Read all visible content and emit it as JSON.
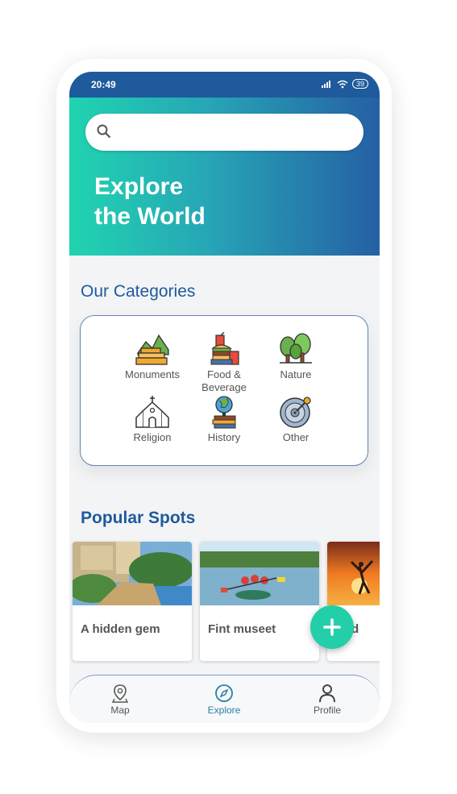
{
  "status_bar": {
    "time": "20:49",
    "battery": "39"
  },
  "search": {
    "placeholder": ""
  },
  "hero": {
    "title_line1": "Explore",
    "title_line2": "the World"
  },
  "categories": {
    "heading": "Our Categories",
    "items": [
      {
        "label": "Monuments",
        "icon": "monument-icon"
      },
      {
        "label": "Food & Beverage",
        "icon": "food-icon"
      },
      {
        "label": "Nature",
        "icon": "trees-icon"
      },
      {
        "label": "Religion",
        "icon": "church-icon"
      },
      {
        "label": "History",
        "icon": "globe-books-icon"
      },
      {
        "label": "Other",
        "icon": "vinyl-icon"
      }
    ]
  },
  "popular": {
    "heading": "Popular Spots",
    "spots": [
      {
        "title": "A hidden gem"
      },
      {
        "title": "Fint museet"
      },
      {
        "title": "And"
      }
    ]
  },
  "fab": {
    "icon": "plus-icon"
  },
  "nav": {
    "items": [
      {
        "label": "Map",
        "icon": "map-pin-icon"
      },
      {
        "label": "Explore",
        "icon": "compass-icon",
        "active": true
      },
      {
        "label": "Profile",
        "icon": "user-icon"
      }
    ]
  },
  "colors": {
    "accent": "#1e5a9c",
    "teal": "#22cfa8",
    "active_nav": "#2a7ea6"
  }
}
